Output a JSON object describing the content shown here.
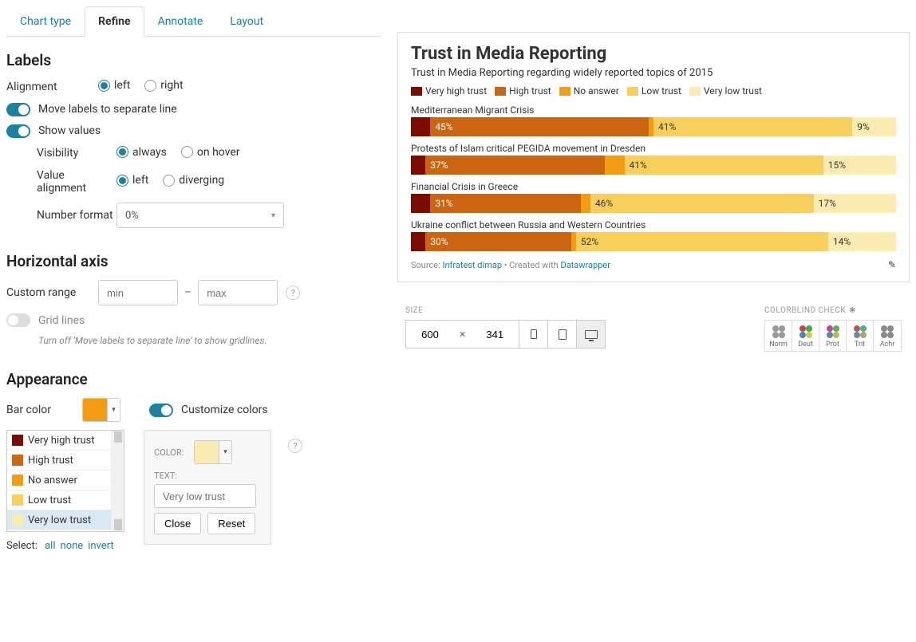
{
  "tabs": [
    "Chart type",
    "Refine",
    "Annotate",
    "Layout"
  ],
  "activeTab": 1,
  "sections": {
    "labels": {
      "title": "Labels",
      "alignment": {
        "label": "Alignment",
        "options": [
          "left",
          "right"
        ],
        "value": "left"
      },
      "moveLabels": {
        "label": "Move labels to separate line",
        "value": true
      },
      "showValues": {
        "label": "Show values",
        "value": true
      },
      "visibility": {
        "label": "Visibility",
        "options": [
          "always",
          "on hover"
        ],
        "value": "always"
      },
      "valueAlign": {
        "label": "Value alignment",
        "options": [
          "left",
          "diverging"
        ],
        "value": "left"
      },
      "numberFormat": {
        "label": "Number format",
        "value": "0%"
      }
    },
    "haxis": {
      "title": "Horizontal axis",
      "customRange": {
        "label": "Custom range",
        "min": "",
        "max": "",
        "minPh": "min",
        "maxPh": "max"
      },
      "gridLines": {
        "label": "Grid lines",
        "value": false,
        "hint": "Turn off 'Move labels to separate line' to show gridlines."
      }
    },
    "appearance": {
      "title": "Appearance",
      "barColor": {
        "label": "Bar color",
        "value": "#F39C12"
      },
      "customize": {
        "label": "Customize colors",
        "value": true
      },
      "categories": [
        {
          "name": "Very high trust",
          "color": "#7A0C00"
        },
        {
          "name": "High trust",
          "color": "#CC6510"
        },
        {
          "name": "No answer",
          "color": "#F39C12"
        },
        {
          "name": "Low trust",
          "color": "#F8CF5C"
        },
        {
          "name": "Very low trust",
          "color": "#FAEBB0"
        }
      ],
      "selectedCat": 4,
      "form": {
        "colorLabel": "COLOR:",
        "textLabel": "TEXT:",
        "textPh": "Very low trust",
        "close": "Close",
        "reset": "Reset"
      },
      "selectRow": {
        "label": "Select:",
        "links": [
          "all",
          "none",
          "invert"
        ]
      }
    }
  },
  "chart_data": {
    "type": "bar",
    "title": "Trust in Media Reporting",
    "subtitle": "Trust in Media Reporting regarding widely reported topics of 2015",
    "series": [
      {
        "name": "Very high trust",
        "color": "#7A0C00"
      },
      {
        "name": "High trust",
        "color": "#CC6510"
      },
      {
        "name": "No answer",
        "color": "#F39C12"
      },
      {
        "name": "Low trust",
        "color": "#F8CF5C"
      },
      {
        "name": "Very low trust",
        "color": "#FAEBB0"
      }
    ],
    "categories": [
      "Mediterranean Migrant Crisis",
      "Protests of Islam critical PEGIDA movement in Dresden",
      "Financial Crisis in Greece",
      "Ukraine conflict between Russia and Western Countries"
    ],
    "values": [
      [
        4,
        45,
        1,
        41,
        9
      ],
      [
        3,
        37,
        4,
        41,
        15
      ],
      [
        4,
        31,
        2,
        46,
        17
      ],
      [
        3,
        30,
        1,
        52,
        14
      ]
    ],
    "labeled_segments": [
      [
        null,
        "45%",
        null,
        "41%",
        "9%"
      ],
      [
        null,
        "37%",
        null,
        "41%",
        "15%"
      ],
      [
        null,
        "31%",
        null,
        "46%",
        "17%"
      ],
      [
        null,
        "30%",
        null,
        "52%",
        "14%"
      ]
    ],
    "source": {
      "prefix": "Source: ",
      "name": "Infratest dimap",
      "mid": " • Created with ",
      "tool": "Datawrapper"
    }
  },
  "preview": {
    "sizeLabel": "SIZE",
    "width": "600",
    "height": "341",
    "cbLabel": "COLORBLIND CHECK",
    "cbModes": [
      "Norm",
      "Deut",
      "Prot",
      "Trit",
      "Achr"
    ]
  }
}
